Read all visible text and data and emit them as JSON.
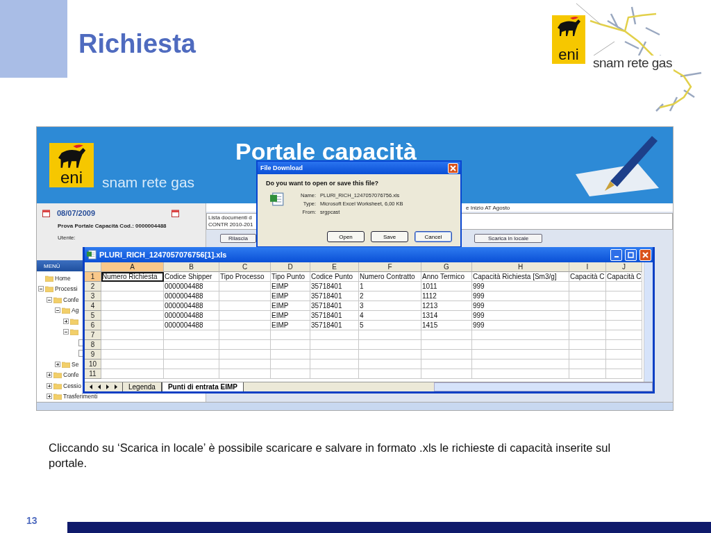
{
  "slide": {
    "title": "Richiesta",
    "logo": {
      "brand": "eni",
      "wordmark": "snam rete gas"
    },
    "caption": "Cliccando su ‘Scarica in locale’ è possibile scaricare e salvare in formato .xls le richieste di capacità inserite sul portale.",
    "page_number": "13"
  },
  "portal": {
    "logo": {
      "brand": "eni",
      "wordmark": "snam rete gas"
    },
    "title": "Portale capacità",
    "date": "08/07/2009",
    "company": "Prova Portale Capacità Cod.: 0000004488",
    "user_label": "Utente:",
    "menu_label": "MENÙ",
    "tree": [
      {
        "label": "Home"
      },
      {
        "label": "Processi",
        "expanded": true,
        "children": [
          {
            "label": "Confe",
            "expanded": true,
            "children": [
              {
                "label": "Ag",
                "expanded": true,
                "children": [
                  {
                    "expanded": false
                  },
                  {
                    "expanded": true,
                    "children": [
                      {
                        "kind": "file"
                      },
                      {
                        "kind": "file"
                      }
                    ]
                  }
                ]
              },
              {
                "label": "Se",
                "expanded": false
              }
            ]
          },
          {
            "label": "Confe",
            "expanded": false
          },
          {
            "label": "Cessio",
            "expanded": false
          },
          {
            "label": "Trasferimenti",
            "expanded": false
          }
        ]
      }
    ],
    "panel": {
      "header_text": "e Inizio AT Agosto",
      "list_lines": [
        "Lista documenti d",
        "CONTR 2010-201"
      ],
      "buttons": [
        "Rilascia",
        "Scarica in locale"
      ]
    }
  },
  "download_dialog": {
    "title": "File Download",
    "question": "Do you want to open or save this file?",
    "fields": [
      {
        "label": "Name:",
        "value": "PLURI_RICH_1247057076756.xls"
      },
      {
        "label": "Type:",
        "value": "Microsoft Excel Worksheet, 6,00 KB"
      },
      {
        "label": "From:",
        "value": "srgpcast"
      }
    ],
    "buttons": [
      {
        "label": "Open",
        "focused": false
      },
      {
        "label": "Save",
        "focused": false
      },
      {
        "label": "Cancel",
        "focused": true
      }
    ]
  },
  "excel": {
    "title": "PLURI_RICH_1247057076756[1].xls",
    "columns": [
      {
        "letter": "A",
        "selected": true
      },
      {
        "letter": "B",
        "selected": false
      },
      {
        "letter": "C",
        "selected": false
      },
      {
        "letter": "D",
        "selected": false
      },
      {
        "letter": "E",
        "selected": false
      },
      {
        "letter": "F",
        "selected": false
      },
      {
        "letter": "G",
        "selected": false
      },
      {
        "letter": "H",
        "selected": false
      },
      {
        "letter": "I",
        "selected": false
      },
      {
        "letter": "J",
        "selected": false
      }
    ],
    "rows": [
      {
        "number": "1",
        "selected": true,
        "cells": {
          "A": "Numero Richiesta",
          "B": "Codice Shipper",
          "C": "Tipo Processo",
          "D": "Tipo Punto",
          "E": "Codice Punto",
          "F": "Numero Contratto",
          "G": "Anno Termico",
          "H": "Capacità Richiesta [Sm3/g]",
          "I": "Capacità C",
          "J": "Capacità C"
        }
      },
      {
        "number": "2",
        "selected": false,
        "cells": {
          "B": "0000004488",
          "D": "EIMP",
          "E": "35718401",
          "F": "1",
          "G": "1011",
          "H": "999"
        }
      },
      {
        "number": "3",
        "selected": false,
        "cells": {
          "B": "0000004488",
          "D": "EIMP",
          "E": "35718401",
          "F": "2",
          "G": "1112",
          "H": "999"
        }
      },
      {
        "number": "4",
        "selected": false,
        "cells": {
          "B": "0000004488",
          "D": "EIMP",
          "E": "35718401",
          "F": "3",
          "G": "1213",
          "H": "999"
        }
      },
      {
        "number": "5",
        "selected": false,
        "cells": {
          "B": "0000004488",
          "D": "EIMP",
          "E": "35718401",
          "F": "4",
          "G": "1314",
          "H": "999"
        }
      },
      {
        "number": "6",
        "selected": false,
        "cells": {
          "B": "0000004488",
          "D": "EIMP",
          "E": "35718401",
          "F": "5",
          "G": "1415",
          "H": "999"
        }
      },
      {
        "number": "7",
        "selected": false
      },
      {
        "number": "8",
        "selected": false
      },
      {
        "number": "9",
        "selected": false
      },
      {
        "number": "10",
        "selected": false
      },
      {
        "number": "11",
        "selected": false
      }
    ],
    "sheet_tabs": [
      {
        "label": "Legenda",
        "selected": false
      },
      {
        "label": "Punti di entrata EIMP",
        "selected": true
      }
    ]
  }
}
